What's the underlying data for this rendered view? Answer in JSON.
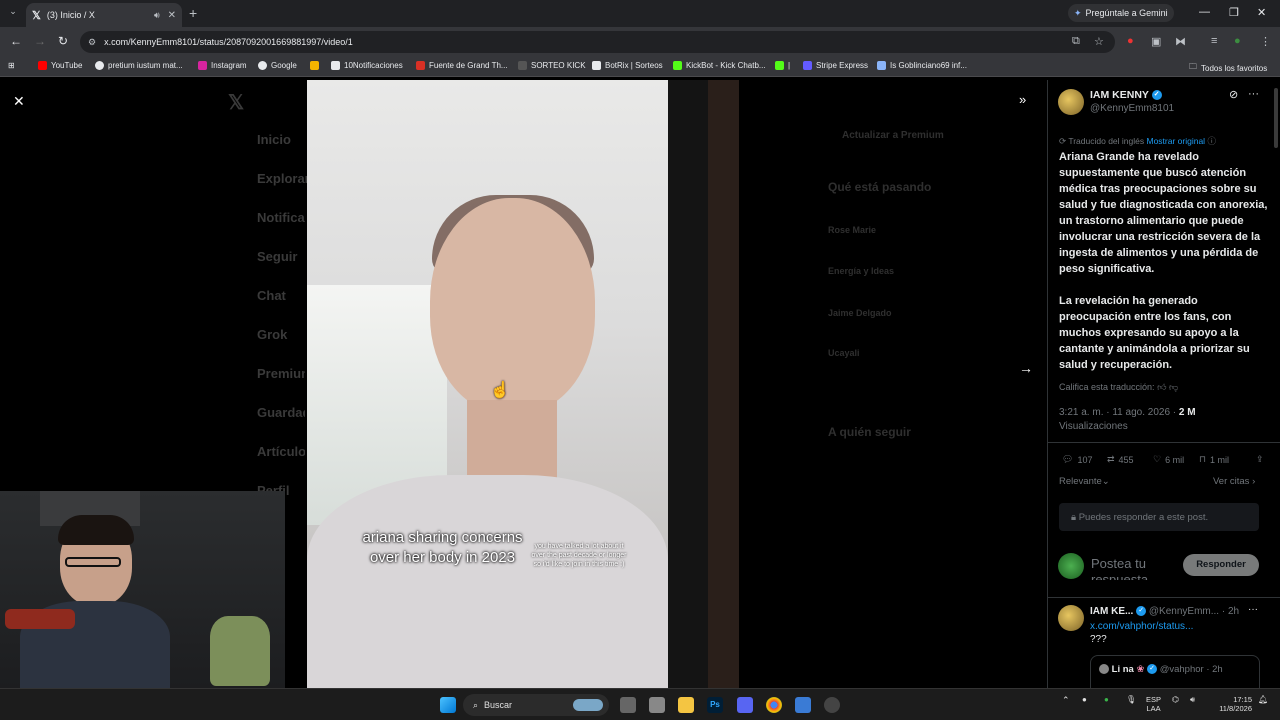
{
  "browser": {
    "tab_title": "(3) Inicio / X",
    "address": "x.com/KennyEmm8101/status/2087092001669881997/video/1",
    "gemini_label": "Pregúntale a Gemini",
    "bookmarks": [
      {
        "label": "YouTube",
        "color": "#ff0000"
      },
      {
        "label": "pretium iustum mat...",
        "color": "#e8eaed"
      },
      {
        "label": "Instagram",
        "color": "#d6249f"
      },
      {
        "label": "Google",
        "color": "#e8eaed"
      },
      {
        "label": "",
        "color": "#f4b400"
      },
      {
        "label": "10Notificaciones",
        "color": "#e8eaed"
      },
      {
        "label": "Fuente de Grand Th...",
        "color": "#d93025"
      },
      {
        "label": "SORTEO KICK",
        "color": "#333"
      },
      {
        "label": "BotRix | Sorteos",
        "color": "#e8eaed"
      },
      {
        "label": "KickBot - Kick Chatb...",
        "color": "#53fc18"
      },
      {
        "label": "|",
        "color": "#53fc18"
      },
      {
        "label": "Stripe Express",
        "color": "#635bff"
      },
      {
        "label": "Is Goblinciano69 inf...",
        "color": "#8ab4f8"
      }
    ],
    "all_bookmarks": "Todos los favoritos"
  },
  "video": {
    "caption_main": "ariana sharing concerns over her body in 2023",
    "caption_small": "you have talked a lot about it over the past decade or longer so i'd like to join in this time :)"
  },
  "post": {
    "author_name": "IAM KENNY",
    "author_handle": "@KennyEmm8101",
    "translated_from": "Traducido del inglés",
    "show_original": "Mostrar original",
    "paragraph1": "Ariana Grande ha revelado supuestamente que buscó atención médica tras preocupaciones sobre su salud y fue diagnosticada con anorexia, un trastorno alimentario que puede involucrar una restricción severa de la ingesta de alimentos y una pérdida de peso significativa.",
    "paragraph2": "La revelación ha generado preocupación entre los fans, con muchos expresando su apoyo a la cantante y animándola a priorizar su salud y recuperación.",
    "rate_translation": "Califica esta traducción:",
    "timestamp": "3:21 a. m. · 11 ago. 2026 ·",
    "views_count": "2 M",
    "views_label": "Visualizaciones",
    "replies": "107",
    "reposts": "455",
    "likes": "6 mil",
    "bookmarks": "1 mil",
    "sort_label": "Relevante",
    "quotes_link": "Ver citas",
    "can_reply_notice": "Puedes responder a este post.",
    "reply_placeholder": "Postea tu respuesta",
    "reply_button": "Responder",
    "reply": {
      "author_name": "IAM KE...",
      "author_handle": "@KennyEmm...",
      "age": "· 2h",
      "link": "x.com/vahphor/status...",
      "text": "???",
      "quoted_author": "Li na",
      "quoted_handle": "@vahphor",
      "quoted_age": "· 2h"
    }
  },
  "background_nav": [
    "Inicio",
    "Explorar",
    "Notificaciones",
    "Seguir",
    "Chat",
    "Grok",
    "Premium",
    "Guardados",
    "Artículos",
    "Perfil"
  ],
  "background_right": {
    "premium_btn": "Actualizar a Premium",
    "trending_title": "Qué está pasando",
    "trends": [
      "Rose Marie",
      "Energía y Ideas",
      "Jaime Delgado",
      "Ucayali"
    ],
    "who_to_follow": "A quién seguir"
  },
  "taskbar": {
    "search_label": "Buscar",
    "language": "ESP",
    "layout": "LAA",
    "time": "17:15",
    "date": "11/8/2026"
  }
}
